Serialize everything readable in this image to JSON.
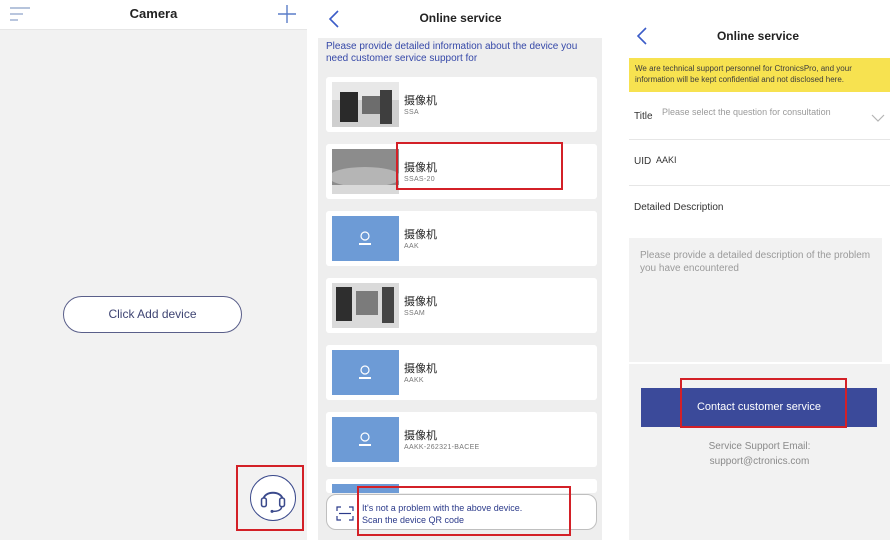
{
  "panel_camera": {
    "title": "Camera",
    "add_device_label": "Click Add device",
    "icons": {
      "menu": "menu-icon",
      "add": "plus-icon",
      "support": "headset-icon"
    }
  },
  "panel_online_service": {
    "title": "Online service",
    "instruction": "Please provide detailed information about the device you need customer service support for",
    "devices": [
      {
        "name": "摄像机",
        "id": "SSA",
        "thumb": "room-photo"
      },
      {
        "name": "摄像机",
        "id": "SSAS-20",
        "thumb": "desk-photo"
      },
      {
        "name": "摄像机",
        "id": "AAK",
        "thumb": "camera-placeholder"
      },
      {
        "name": "摄像机",
        "id": "SSAM",
        "thumb": "room-photo"
      },
      {
        "name": "摄像机",
        "id": "AAKK",
        "thumb": "camera-placeholder"
      },
      {
        "name": "摄像机",
        "id": "AAKK-262321-BACEE",
        "thumb": "camera-placeholder"
      }
    ],
    "qr_line1": "It's not a problem with the above device.",
    "qr_line2": "Scan the device QR code"
  },
  "panel_form": {
    "title": "Online service",
    "notice": "We are technical support personnel for CtronicsPro, and your information will be kept confidential and not disclosed here.",
    "title_label": "Title",
    "title_placeholder": "Please select the question for consultation",
    "uid_label": "UID",
    "uid_value": "AAKI",
    "desc_label": "Detailed Description",
    "desc_placeholder": "Please provide a detailed description of the problem you have encountered",
    "contact_button": "Contact customer service",
    "email_label": "Service Support Email:",
    "email_value": "support@ctronics.com"
  },
  "colors": {
    "accent": "#3b4a9a",
    "highlight": "#d32027",
    "notice_bg": "#f7e250",
    "link": "#3548a8"
  }
}
